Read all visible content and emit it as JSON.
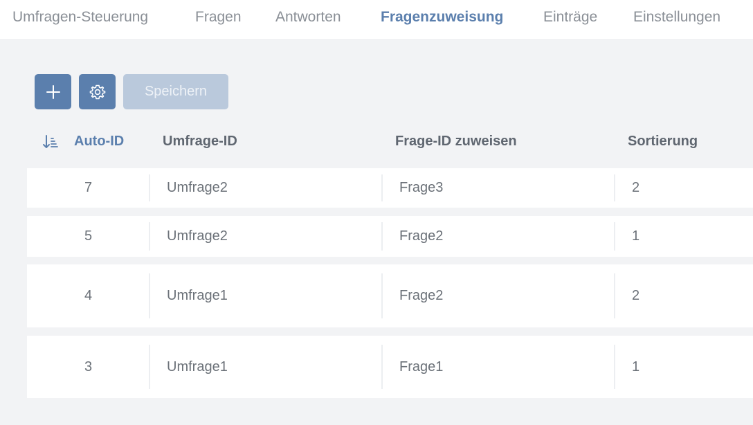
{
  "tabs": [
    {
      "label": "Umfragen-Steuerung",
      "active": false
    },
    {
      "label": "Fragen",
      "active": false
    },
    {
      "label": "Antworten",
      "active": false
    },
    {
      "label": "Fragenzuweisung",
      "active": true
    },
    {
      "label": "Einträge",
      "active": false
    },
    {
      "label": "Einstellungen",
      "active": false
    }
  ],
  "toolbar": {
    "add_icon": "plus-icon",
    "settings_icon": "gear-icon",
    "save_label": "Speichern"
  },
  "table": {
    "sort_icon": "sort-ascending-icon",
    "columns": [
      "Auto-ID",
      "Umfrage-ID",
      "Frage-ID zuweisen",
      "Sortierung"
    ],
    "rows": [
      [
        "7",
        "Umfrage2",
        "Frage3",
        "2"
      ],
      [
        "5",
        "Umfrage2",
        "Frage2",
        "1"
      ],
      [
        "4",
        "Umfrage1",
        "Frage2",
        "2"
      ],
      [
        "3",
        "Umfrage1",
        "Frage1",
        "1"
      ]
    ]
  },
  "colors": {
    "accent": "#5b7fad",
    "accent_disabled": "#bac9dc",
    "background": "#f2f3f5"
  }
}
